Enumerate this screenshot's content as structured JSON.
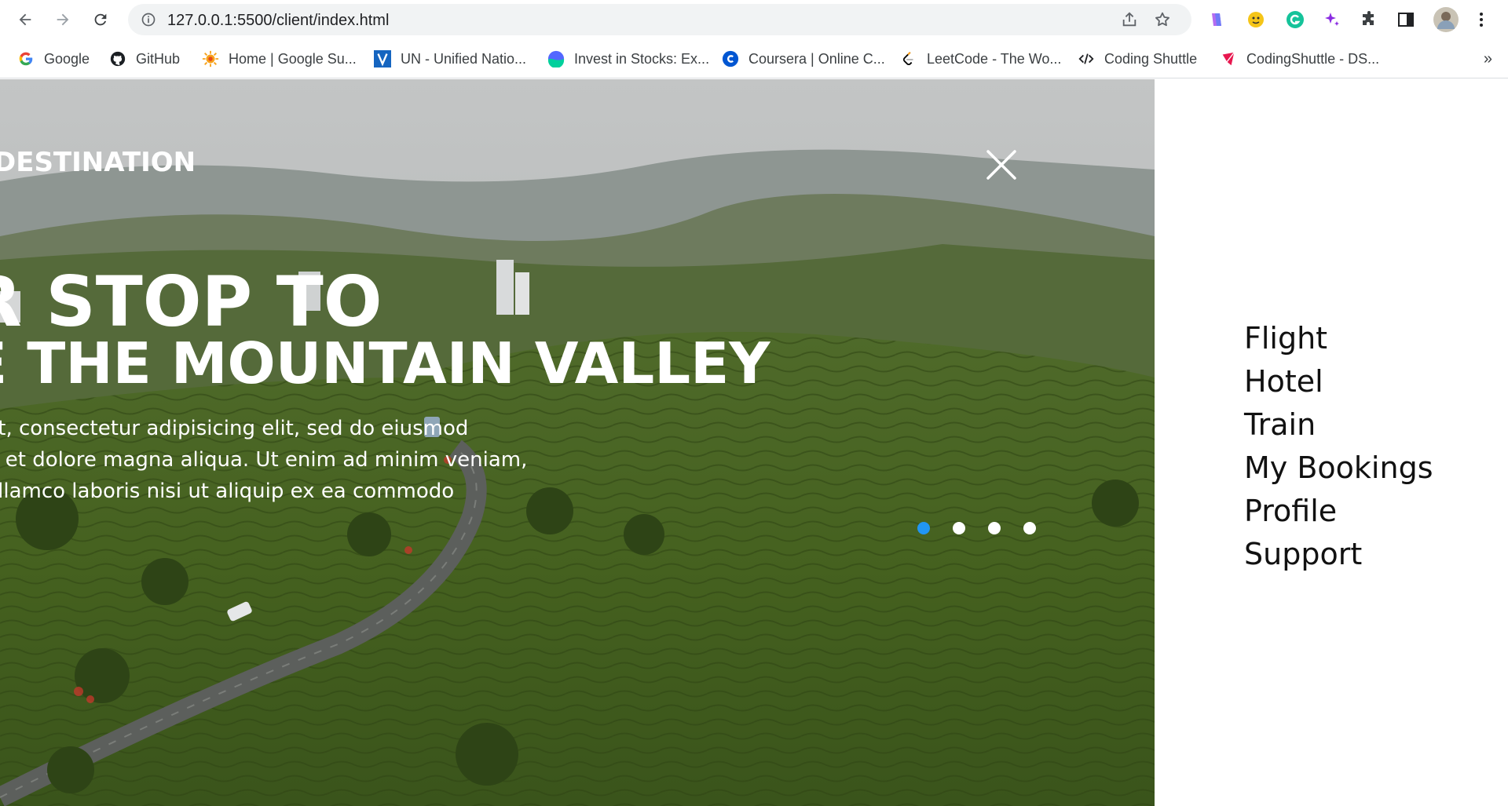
{
  "browser": {
    "url": "127.0.0.1:5500/client/index.html",
    "bookmarks": [
      {
        "label": "Google",
        "icon": "google-icon"
      },
      {
        "label": "GitHub",
        "icon": "github-icon"
      },
      {
        "label": "Home | Google Su...",
        "icon": "google-summer-icon"
      },
      {
        "label": "UN - Unified Natio...",
        "icon": "un-icon"
      },
      {
        "label": "Invest in Stocks: Ex...",
        "icon": "invest-icon"
      },
      {
        "label": "Coursera | Online C...",
        "icon": "coursera-icon"
      },
      {
        "label": "LeetCode - The Wo...",
        "icon": "leetcode-icon"
      },
      {
        "label": "Coding Shuttle",
        "icon": "code-icon"
      },
      {
        "label": "CodingShuttle - DS...",
        "icon": "codingshuttle-icon"
      }
    ],
    "more": "»"
  },
  "hero": {
    "brand": "DESTINATION",
    "headline_line1": "R STOP TO",
    "headline_line2": "E THE MOUNTAIN VALLEY",
    "description": [
      "amet, consectetur adipisicing elit, sed do eiusmod",
      "bore et dolore magna aliqua. Ut enim ad minim veniam,",
      "on ullamco laboris nisi ut aliquip ex ea commodo"
    ],
    "slide_count": 4,
    "active_slide": 1,
    "accent_color": "#2196f3"
  },
  "menu": {
    "items": [
      "Flight",
      "Hotel",
      "Train",
      "My Bookings",
      "Profile",
      "Support"
    ]
  }
}
